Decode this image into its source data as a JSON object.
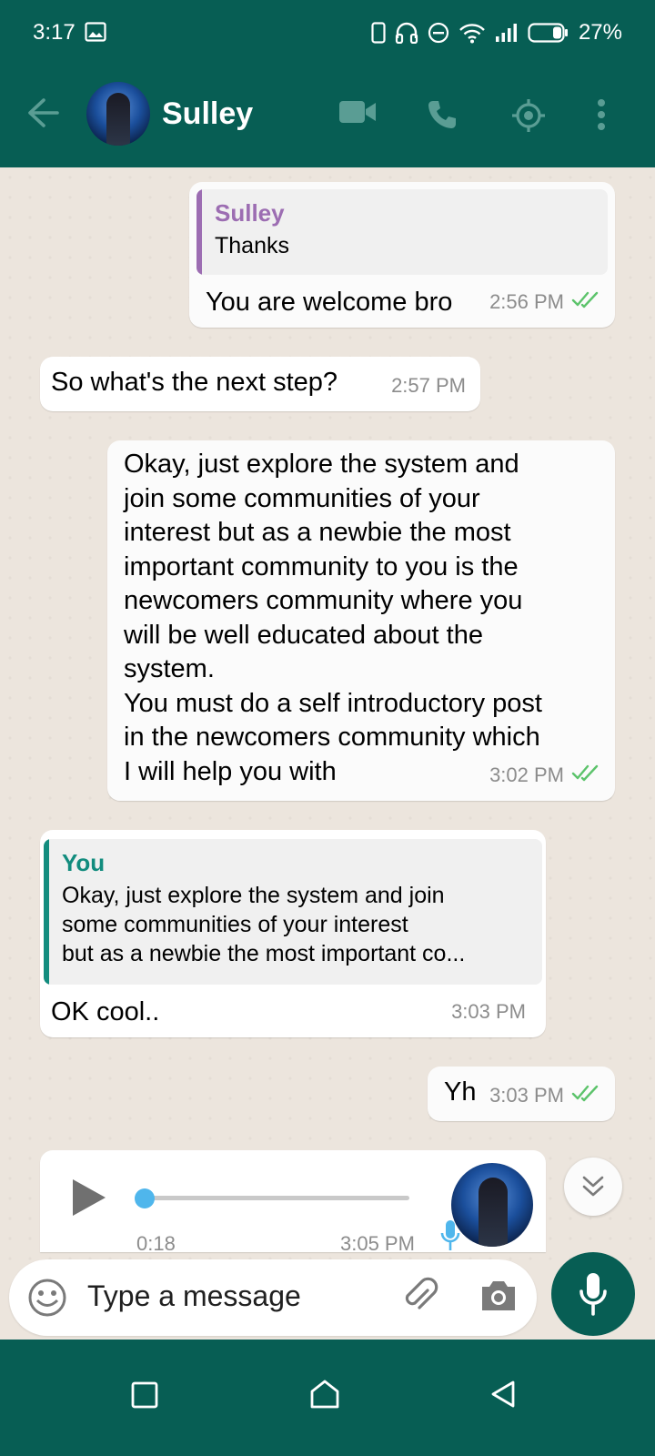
{
  "status_bar": {
    "time": "3:17",
    "battery": "27%",
    "icons": [
      "gallery-icon",
      "phone-outline-icon",
      "headphones-icon",
      "dnd-icon",
      "wifi-icon",
      "signal-icon",
      "battery-icon"
    ]
  },
  "header": {
    "contact_name": "Sulley",
    "icons": [
      "back-arrow-icon",
      "video-call-icon",
      "voice-call-icon",
      "location-icon",
      "more-vert-icon"
    ]
  },
  "messages": [
    {
      "direction": "outgoing",
      "quote": {
        "author": "Sulley",
        "text": "Thanks",
        "color": "#9c6db2"
      },
      "text": "You are welcome bro",
      "time": "2:56 PM",
      "read": true
    },
    {
      "direction": "incoming",
      "text": "So what's the next step?",
      "time": "2:57 PM"
    },
    {
      "direction": "outgoing",
      "lines": [
        "Okay, just explore the system and",
        "join some communities of your",
        "interest but as a newbie the most",
        "important community to you is the",
        "newcomers community where you",
        "will be well educated about the",
        "system.",
        "You must do a self introductory post",
        "in the newcomers community which",
        "I will help you with"
      ],
      "time": "3:02 PM",
      "read": true
    },
    {
      "direction": "incoming",
      "quote": {
        "author": "You",
        "lines": [
          "Okay, just explore the system and join",
          "some communities of your interest",
          "but as a newbie the most important co..."
        ],
        "color": "#128c7e"
      },
      "text": "OK cool..",
      "time": "3:03 PM"
    },
    {
      "direction": "outgoing",
      "text": "Yh",
      "time": "3:03 PM",
      "read": true
    },
    {
      "direction": "incoming",
      "type": "voice",
      "duration": "0:18",
      "time": "3:05 PM"
    }
  ],
  "composer": {
    "placeholder": "Type a message",
    "icons": [
      "emoji-icon",
      "attach-icon",
      "camera-icon",
      "mic-icon"
    ]
  },
  "colors": {
    "header": "#075e54",
    "chat_bg": "#ece5dd",
    "tick_read": "#4fc3f7",
    "tick_green": "#34b7f1",
    "voice_dot": "#4fb6ec"
  }
}
